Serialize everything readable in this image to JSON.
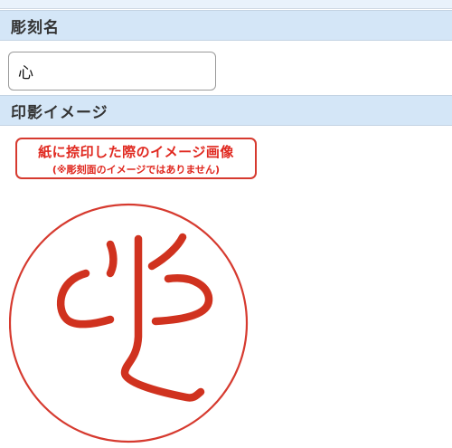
{
  "form": {
    "engraving_name": {
      "header": "彫刻名",
      "value": "心"
    },
    "imprint_image": {
      "header": "印影イメージ",
      "notice_main": "紙に捺印した際のイメージ画像",
      "notice_sub": "(※彫刻面のイメージではありません)",
      "seal_character": "心"
    }
  },
  "colors": {
    "header_bg": "#d4e6f7",
    "seal_red": "#d63a2f"
  }
}
